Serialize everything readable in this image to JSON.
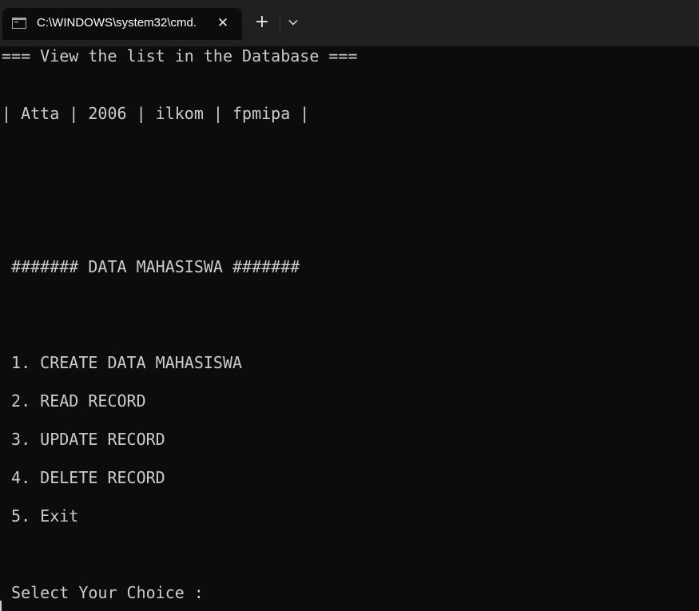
{
  "window": {
    "tab_title": "C:\\WINDOWS\\system32\\cmd.",
    "tab_icon": "console-icon",
    "close_icon": "close-icon",
    "new_tab_label": "+",
    "dropdown_icon": "chevron-down-icon"
  },
  "console": {
    "header": "=== View the list in the Database ===",
    "record_row": "| Atta | 2006 | ilkom | fpmipa |",
    "menu_title": " ####### DATA MAHASISWA #######",
    "menu_items": [
      " 1. CREATE DATA MAHASISWA",
      " 2. READ RECORD",
      " 3. UPDATE RECORD",
      " 4. DELETE RECORD",
      " 5. Exit"
    ],
    "prompt": " Select Your Choice :"
  },
  "colors": {
    "background": "#0c0c0c",
    "titlebar": "#202020",
    "text": "#cccccc"
  }
}
